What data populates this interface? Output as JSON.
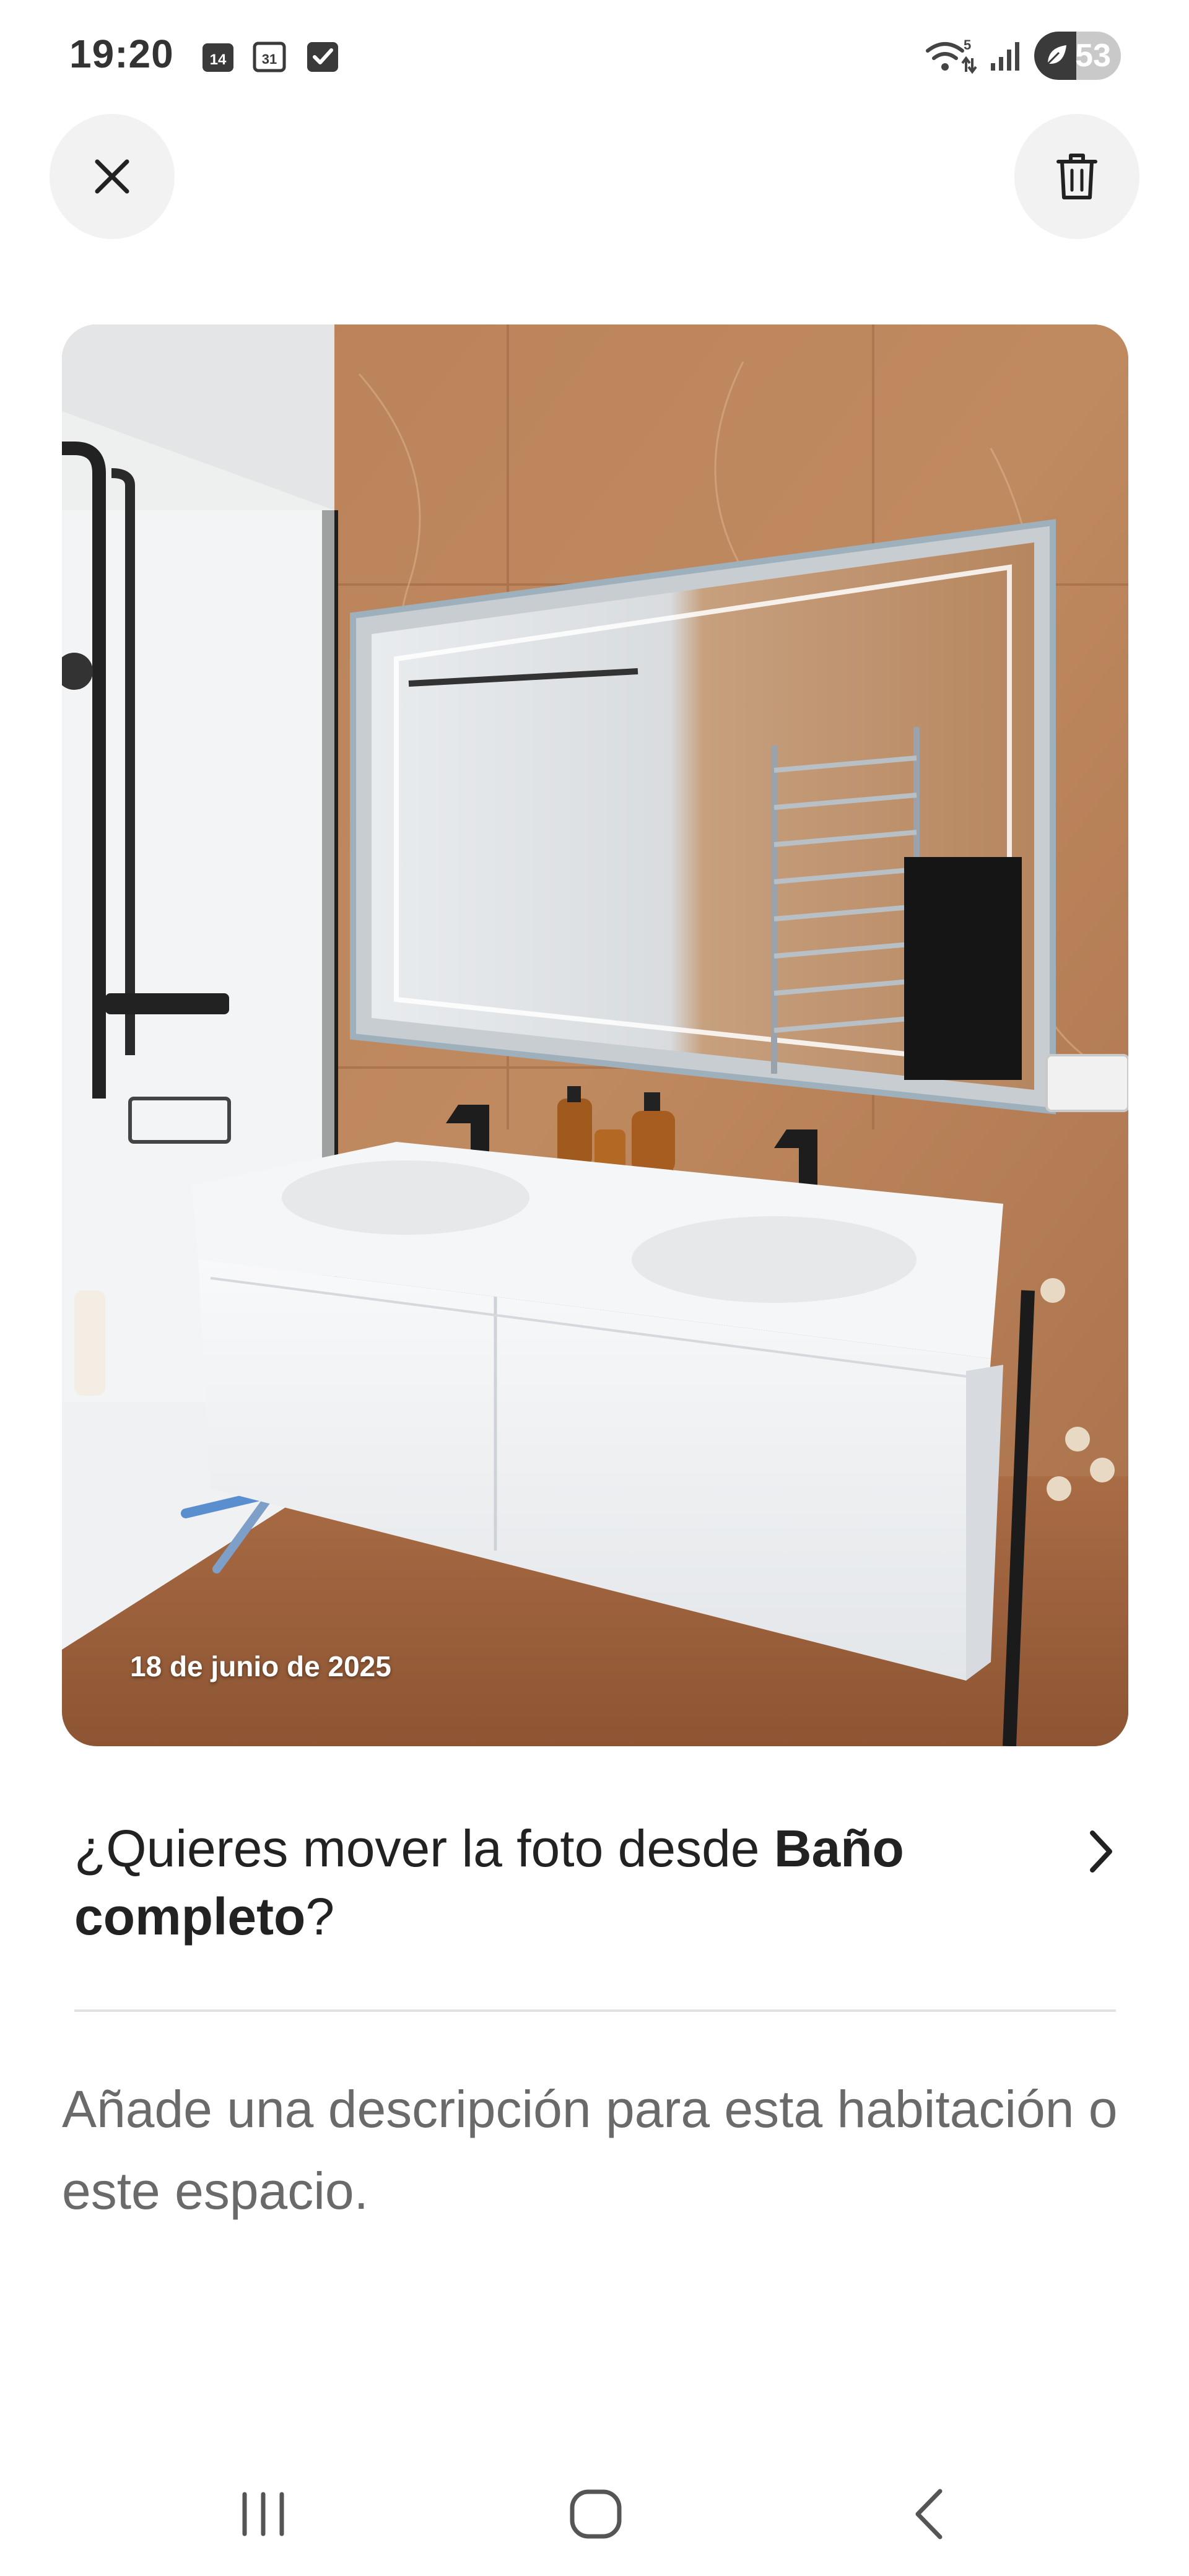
{
  "status_bar": {
    "time": "19:20",
    "notification_icons": [
      "calendar-14-icon",
      "calendar-31-icon",
      "checkbox-icon"
    ],
    "calendar_day_a": "14",
    "calendar_day_b": "31",
    "wifi_label": "5",
    "battery_level": "53"
  },
  "header": {
    "close_icon": "close-icon",
    "delete_icon": "trash-icon"
  },
  "photo": {
    "date_stamp": "18 de junio de 2025",
    "subject": "bathroom-vanity-photo"
  },
  "move_prompt": {
    "prefix": "¿Quieres mover la foto desde ",
    "room_name": "Baño completo",
    "suffix": "?",
    "chevron_icon": "chevron-right-icon"
  },
  "description": {
    "placeholder": "Añade una descripción para esta habitación o este espacio."
  },
  "nav_bar": {
    "recent_icon": "recent-apps-icon",
    "home_icon": "home-icon",
    "back_icon": "back-icon"
  },
  "colors": {
    "background": "#ffffff",
    "button_bg": "#f2f2f2",
    "text_primary": "#222222",
    "text_secondary": "#6a6a6a",
    "divider": "#e2e2e2"
  }
}
